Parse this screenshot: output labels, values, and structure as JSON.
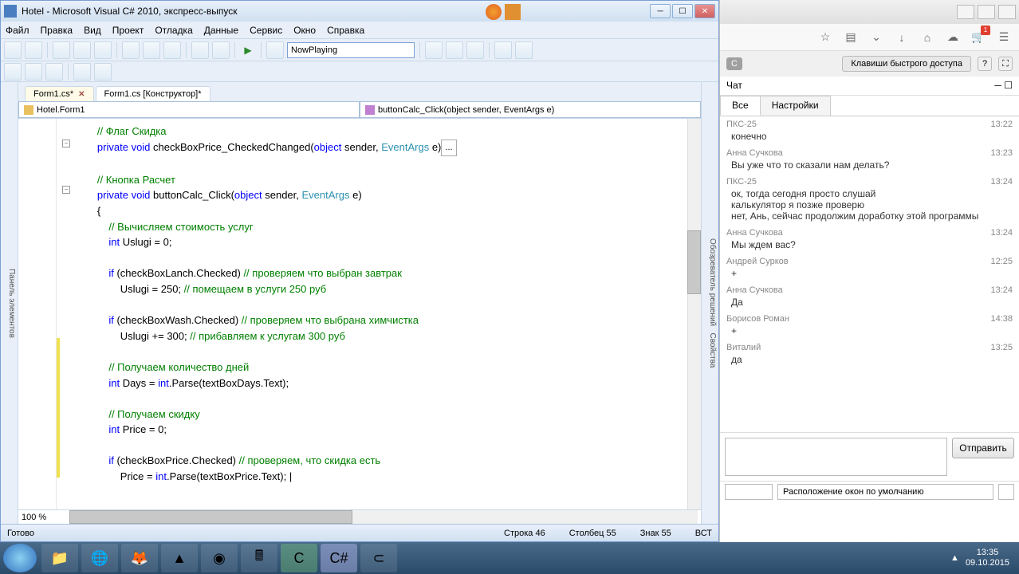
{
  "vs": {
    "title": "Hotel - Microsoft Visual C# 2010, экспресс-выпуск",
    "menu": [
      "Файл",
      "Правка",
      "Вид",
      "Проект",
      "Отладка",
      "Данные",
      "Сервис",
      "Окно",
      "Справка"
    ],
    "config_combo": "NowPlaying",
    "sidebar_left": "Панель элементов",
    "sidebar_right_top": "Обозреватель решений",
    "sidebar_right_bot": "Свойства",
    "tabs": [
      {
        "label": "Form1.cs*",
        "active": true
      },
      {
        "label": "Form1.cs [Конструктор]*",
        "active": false
      }
    ],
    "dd_class": "Hotel.Form1",
    "dd_method": "buttonCalc_Click(object sender, EventArgs e)",
    "zoom": "100 %",
    "status": {
      "ready": "Готово",
      "line": "Строка 46",
      "col": "Столбец 55",
      "char": "Знак 55",
      "mode": "ВСТ"
    },
    "code": {
      "c1": "// Флаг Скидка",
      "l2a": "private",
      "l2b": "void",
      "l2c": " checkBoxPrice_CheckedChanged(",
      "l2d": "object",
      "l2e": " sender, ",
      "l2f": "EventArgs",
      "l2g": " e)",
      "c3": "// Кнопка Расчет",
      "l4a": "private",
      "l4b": "void",
      "l4c": " buttonCalc_Click(",
      "l4d": "object",
      "l4e": " sender, ",
      "l4f": "EventArgs",
      "l4g": " e)",
      "l5": "{",
      "c6": "// Вычисляем стоимость услуг",
      "l7a": "int",
      "l7b": " Uslugi = 0;",
      "l8a": "if",
      "l8b": " (checkBoxLanch.Checked) ",
      "c8": "// проверяем что выбран завтрак",
      "l9": "Uslugi = 250; ",
      "c9": "// помещаем в услуги 250 руб",
      "l10a": "if",
      "l10b": " (checkBoxWash.Checked) ",
      "c10": "// проверяем что выбрана химчистка",
      "l11": "Uslugi += 300; ",
      "c11": "// прибавляем к услугам 300 руб",
      "c12": "// Получаем количество дней",
      "l13a": "int",
      "l13b": " Days = ",
      "l13c": "int",
      "l13d": ".Parse(textBoxDays.Text);",
      "c14": "// Получаем скидку",
      "l15a": "int",
      "l15b": " Price = 0;",
      "l16a": "if",
      "l16b": " (checkBoxPrice.Checked) ",
      "c16": "// проверяем, что скидка есть",
      "l17a": "Price = ",
      "l17b": "int",
      "l17c": ".Parse(textBoxPrice.Text); |"
    }
  },
  "chat": {
    "headerc": "С",
    "hotkey": "Клавиши быстрого доступа",
    "help": "?",
    "title": "Чат",
    "tabs": [
      "Все",
      "Настройки"
    ],
    "messages": [
      {
        "from": "ПКС-25",
        "time": "13:22",
        "text": "конечно"
      },
      {
        "from": "Анна Сучкова",
        "time": "13:23",
        "text": "Вы уже что то сказали нам делать?"
      },
      {
        "from": "ПКС-25",
        "time": "13:24",
        "text": "ок, тогда сегодня просто слушай\nкалькулятор я позже проверю\nнет, Ань, сейчас продолжим доработку этой программы"
      },
      {
        "from": "Анна Сучкова",
        "time": "13:24",
        "text": "Мы ждем вас?"
      },
      {
        "from": "Андрей Сурков",
        "time": "12:25",
        "text": "+"
      },
      {
        "from": "Анна Сучкова",
        "time": "13:24",
        "text": "Да"
      },
      {
        "from": "Борисов Роман",
        "time": "14:38",
        "text": "+"
      },
      {
        "from": "Виталий",
        "time": "13:25",
        "text": "да"
      }
    ],
    "send": "Отправить",
    "layout": "Расположение окон по умолчанию"
  },
  "taskbar": {
    "time": "13:35",
    "date": "09.10.2015"
  }
}
